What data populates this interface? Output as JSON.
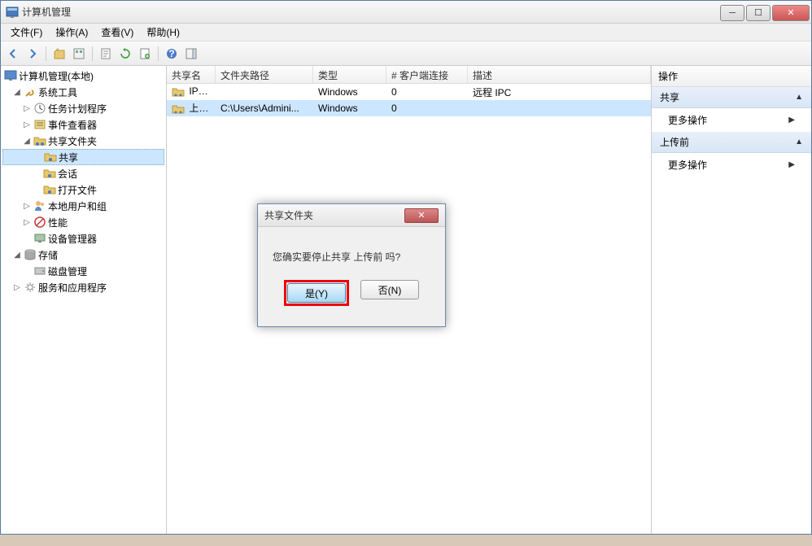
{
  "window": {
    "title": "计算机管理"
  },
  "menu": {
    "file": "文件(F)",
    "operation": "操作(A)",
    "view": "查看(V)",
    "help": "帮助(H)"
  },
  "tree": {
    "root": "计算机管理(本地)",
    "system_tools": "系统工具",
    "task_scheduler": "任务计划程序",
    "event_viewer": "事件查看器",
    "shared_folders": "共享文件夹",
    "shares": "共享",
    "sessions": "会话",
    "open_files": "打开文件",
    "local_users": "本地用户和组",
    "performance": "性能",
    "device_mgr": "设备管理器",
    "storage": "存储",
    "disk_mgmt": "磁盘管理",
    "services_apps": "服务和应用程序"
  },
  "list": {
    "headers": {
      "share_name": "共享名",
      "folder_path": "文件夹路径",
      "type": "类型",
      "client_conn": "# 客户端连接",
      "description": "描述"
    },
    "rows": [
      {
        "name": "IPC$",
        "path": "",
        "type": "Windows",
        "clients": "0",
        "desc": "远程 IPC"
      },
      {
        "name": "上传前",
        "path": "C:\\Users\\Admini...",
        "type": "Windows",
        "clients": "0",
        "desc": ""
      }
    ]
  },
  "actions": {
    "header": "操作",
    "section1": "共享",
    "more1": "更多操作",
    "section2": "上传前",
    "more2": "更多操作"
  },
  "dialog": {
    "title": "共享文件夹",
    "message": "您确实要停止共享 上传前 吗?",
    "yes": "是(Y)",
    "no": "否(N)"
  }
}
